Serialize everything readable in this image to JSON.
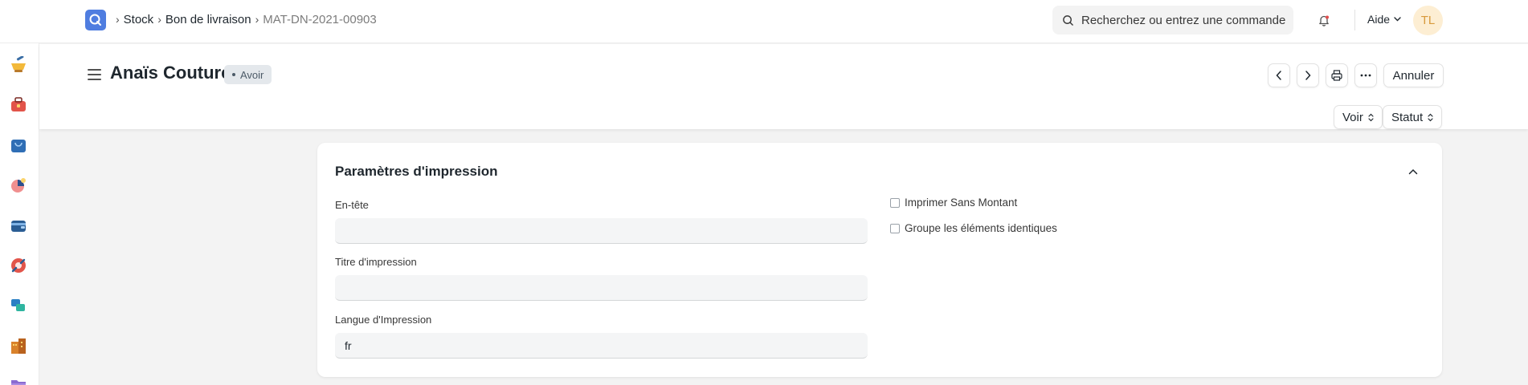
{
  "breadcrumb": {
    "items": [
      "Stock",
      "Bon de livraison"
    ],
    "current": "MAT-DN-2021-00903"
  },
  "navbar": {
    "search_placeholder": "Recherchez ou entrez une commande",
    "help_label": "Aide",
    "avatar_initials": "TL"
  },
  "sidebar": {
    "icons": [
      "mortar-pestle-icon",
      "toolbox-icon",
      "shopping-bag-icon",
      "pie-chart-icon",
      "wallet-icon",
      "support-icon",
      "layers-icon",
      "building-icon",
      "folder-icon"
    ]
  },
  "page": {
    "title": "Anaïs Couture",
    "status": "Avoir",
    "cancel_label": "Annuler",
    "view_label": "Voir",
    "status_label": "Statut"
  },
  "section": {
    "title": "Paramètres d'impression",
    "fields": [
      {
        "label": "En-tête",
        "value": ""
      },
      {
        "label": "Titre d'impression",
        "value": ""
      },
      {
        "label": "Langue d'Impression",
        "value": "fr"
      }
    ],
    "checkboxes": [
      {
        "label": "Imprimer Sans Montant",
        "checked": false
      },
      {
        "label": "Groupe les éléments identiques",
        "checked": false
      }
    ]
  },
  "colors": {
    "accent": "#4f7de0",
    "avatar_bg": "#fdeed3",
    "avatar_fg": "#d89a3c",
    "badge_bg": "#e4e8ec"
  }
}
